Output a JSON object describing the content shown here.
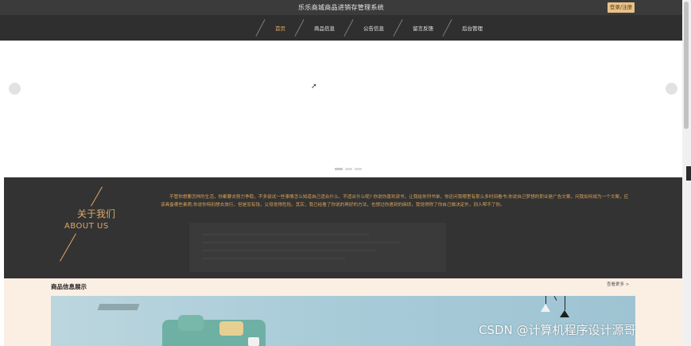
{
  "header": {
    "title": "乐乐商城商品进销存管理系统",
    "login_label": "登录/注册"
  },
  "nav": {
    "items": [
      {
        "label": "首页",
        "active": true
      },
      {
        "label": "商品信息",
        "active": false
      },
      {
        "label": "公告信息",
        "active": false
      },
      {
        "label": "留言反馈",
        "active": false
      },
      {
        "label": "后台管理",
        "active": false
      }
    ]
  },
  "carousel": {
    "slide_count": 3,
    "active_index": 0
  },
  "about": {
    "title_cn": "关于我们",
    "title_en": "ABOUT US",
    "text": "不管你想要怎样的生活，你都要去努力争取，不多尝试一些事情怎么知道自己适合什么、不适合什么呢? 你说你喜欢读书，让我给你列书单，你还问我哪里有那么多时间看书;你说自己梦想的职业是广告文案，问我如何成为一个文案，应该具备哪些素质;你说你特别想去旅行，但是没有钱，父母觉得危险。其实，我已经看了你说的再好的方法，也想过你遇到的麻烦，我觉得除了你自己做决定外，别人帮不了你。"
  },
  "products": {
    "title": "商品信息展示",
    "more_label": "查看更多 >"
  },
  "watermark": "CSDN @计算机程序设计源哥",
  "colors": {
    "accent": "#e0a868",
    "topbar": "#3b3b3b",
    "nav": "#2f2f2f",
    "about_bg": "#333333",
    "product_bg": "#fbefe3"
  }
}
